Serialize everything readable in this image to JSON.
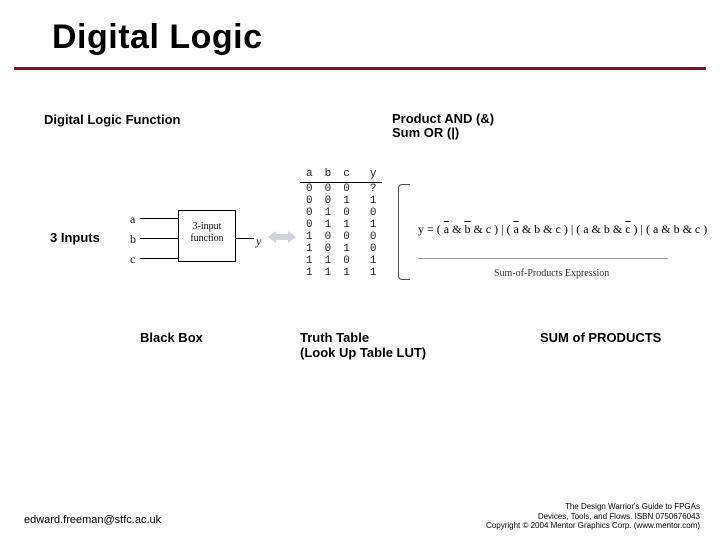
{
  "title": "Digital Logic",
  "left_heading": "Digital Logic Function",
  "right_heading_line1": "Product AND (&)",
  "right_heading_line2": "Sum OR (|)",
  "inputs_label": "3 Inputs",
  "blackbox": {
    "ports_in": [
      "a",
      "b",
      "c"
    ],
    "box_line1": "3-input",
    "box_line2": "function",
    "port_out": "y"
  },
  "truth_table": {
    "headers": [
      "a",
      "b",
      "c",
      "y"
    ],
    "rows": [
      [
        "0",
        "0",
        "0",
        "?"
      ],
      [
        "0",
        "0",
        "1",
        "1"
      ],
      [
        "0",
        "1",
        "0",
        "0"
      ],
      [
        "0",
        "1",
        "1",
        "1"
      ],
      [
        "1",
        "0",
        "0",
        "0"
      ],
      [
        "1",
        "0",
        "1",
        "0"
      ],
      [
        "1",
        "1",
        "0",
        "1"
      ],
      [
        "1",
        "1",
        "1",
        "1"
      ]
    ]
  },
  "expression": {
    "lhs": "y =",
    "terms": [
      {
        "a_bar": true,
        "b_bar": true,
        "c_bar": false
      },
      {
        "a_bar": true,
        "b_bar": false,
        "c_bar": false
      },
      {
        "a_bar": false,
        "b_bar": false,
        "c_bar": true
      },
      {
        "a_bar": false,
        "b_bar": false,
        "c_bar": false
      }
    ],
    "caption": "Sum-of-Products Expression"
  },
  "caption_blackbox": "Black Box",
  "caption_truth_line1": "Truth Table",
  "caption_truth_line2": "(Look Up Table LUT)",
  "caption_sop": "SUM of PRODUCTS",
  "footer_email": "edward.freeman@stfc.ac.uk",
  "footer_ref_line1": "The Design Warrior's Guide to FPGAs",
  "footer_ref_line2": "Devices, Tools, and Flows. ISBN 0750676043",
  "footer_ref_line3": "Copyright © 2004 Mentor Graphics Corp. (www.mentor.com)"
}
